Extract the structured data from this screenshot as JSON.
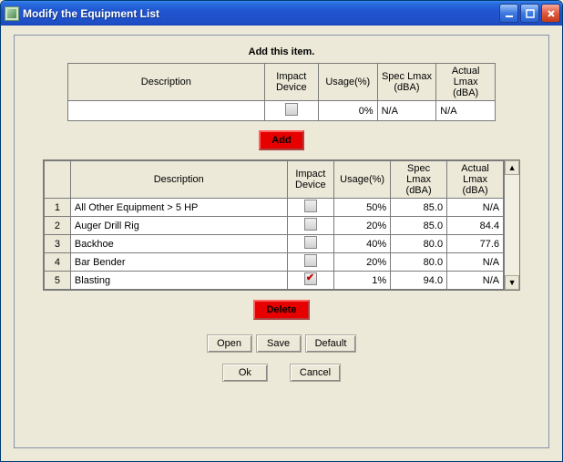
{
  "window": {
    "title": "Modify the Equipment List"
  },
  "add_section": {
    "heading": "Add this item.",
    "headers": {
      "description": "Description",
      "impact": "Impact Device",
      "usage": "Usage(%)",
      "spec": "Spec Lmax (dBA)",
      "actual": "Actual Lmax (dBA)"
    },
    "row": {
      "description": "",
      "impact_checked": false,
      "usage": "0%",
      "spec": "N/A",
      "actual": "N/A"
    }
  },
  "buttons": {
    "add": "Add",
    "delete": "Delete",
    "open": "Open",
    "save": "Save",
    "default": "Default",
    "ok": "Ok",
    "cancel": "Cancel"
  },
  "equip_headers": {
    "description": "Description",
    "impact": "Impact Device",
    "usage": "Usage(%)",
    "spec": "Spec Lmax (dBA)",
    "actual": "Actual Lmax (dBA)"
  },
  "equipment": [
    {
      "n": "1",
      "description": "All Other Equipment > 5 HP",
      "impact_checked": false,
      "usage": "50%",
      "spec": "85.0",
      "actual": "N/A"
    },
    {
      "n": "2",
      "description": "Auger Drill Rig",
      "impact_checked": false,
      "usage": "20%",
      "spec": "85.0",
      "actual": "84.4"
    },
    {
      "n": "3",
      "description": "Backhoe",
      "impact_checked": false,
      "usage": "40%",
      "spec": "80.0",
      "actual": "77.6"
    },
    {
      "n": "4",
      "description": "Bar Bender",
      "impact_checked": false,
      "usage": "20%",
      "spec": "80.0",
      "actual": "N/A"
    },
    {
      "n": "5",
      "description": "Blasting",
      "impact_checked": true,
      "usage": "1%",
      "spec": "94.0",
      "actual": "N/A"
    }
  ]
}
